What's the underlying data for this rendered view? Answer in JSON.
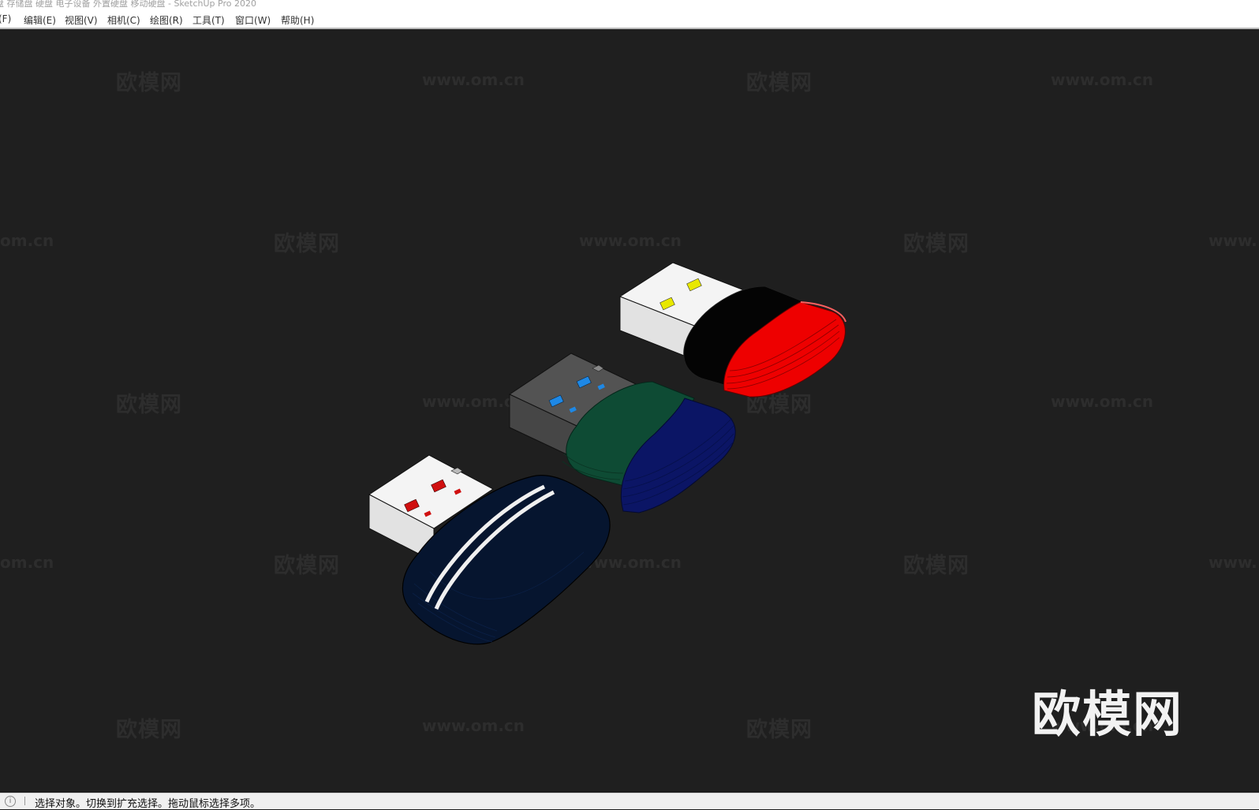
{
  "window": {
    "title": "盘 存储盘 硬盘 电子设备 外置硬盘 移动硬盘 - SketchUp Pro 2020"
  },
  "menu": {
    "items": [
      {
        "label": "(F)"
      },
      {
        "label": "编辑(E)"
      },
      {
        "label": "视图(V)"
      },
      {
        "label": "相机(C)"
      },
      {
        "label": "绘图(R)"
      },
      {
        "label": "工具(T)"
      },
      {
        "label": "窗口(W)"
      },
      {
        "label": "帮助(H)"
      }
    ]
  },
  "watermarks": {
    "brand": "欧模网",
    "url": "www.om.cn",
    "url_partial_left": "om.cn",
    "url_partial_right": "www."
  },
  "logo": {
    "text": "欧模网"
  },
  "status": {
    "icon": "info-icon",
    "message": "选择对象。切换到扩充选择。拖动鼠标选择多项。"
  },
  "scene": {
    "models": [
      {
        "name": "usb-drive-black-red",
        "body_colors": [
          "#000000",
          "#ee0000"
        ],
        "connector_color": "#f2f2f2",
        "contact_color": "#e6e600"
      },
      {
        "name": "usb-drive-green-blue",
        "body_colors": [
          "#0e4b34",
          "#0b1565"
        ],
        "connector_color": "#505050",
        "contact_color": "#1e88e5"
      },
      {
        "name": "usb-drive-navy-striped",
        "body_colors": [
          "#06152f"
        ],
        "connector_color": "#f2f2f2",
        "contact_color": "#d01010"
      }
    ]
  }
}
